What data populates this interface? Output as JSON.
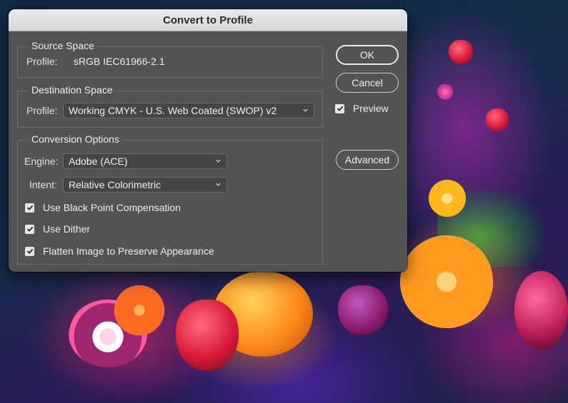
{
  "dialog": {
    "title": "Convert to Profile",
    "source_space": {
      "legend": "Source Space",
      "profile_label": "Profile:",
      "profile_value": "sRGB IEC61966-2.1"
    },
    "destination_space": {
      "legend": "Destination Space",
      "profile_label": "Profile:",
      "profile_selected": "Working CMYK - U.S. Web Coated (SWOP) v2"
    },
    "conversion_options": {
      "legend": "Conversion Options",
      "engine_label": "Engine:",
      "engine_selected": "Adobe (ACE)",
      "intent_label": "Intent:",
      "intent_selected": "Relative Colorimetric",
      "checkboxes": [
        {
          "label": "Use Black Point Compensation",
          "checked": true
        },
        {
          "label": "Use Dither",
          "checked": true
        },
        {
          "label": "Flatten Image to Preserve Appearance",
          "checked": true
        }
      ]
    },
    "buttons": {
      "ok": "OK",
      "cancel": "Cancel",
      "advanced": "Advanced"
    },
    "preview": {
      "label": "Preview",
      "checked": true
    }
  },
  "icons": {
    "dropdown": "chevron-down-icon",
    "checkbox": "checkmark-icon"
  },
  "colors": {
    "dialog_background": "#535353",
    "titlebar_background": "#e0e0e0",
    "text": "#ededed"
  }
}
